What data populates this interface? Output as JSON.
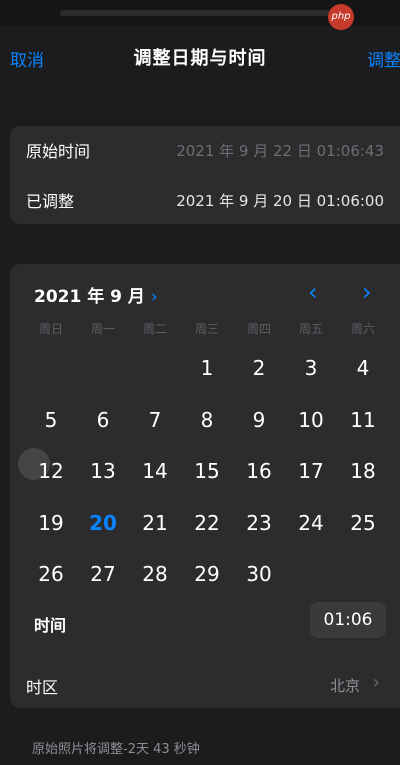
{
  "header": {
    "cancel": "取消",
    "title": "调整日期与时间",
    "adjust": "调整"
  },
  "watermark": "php",
  "original": {
    "label": "原始时间",
    "value": "2021 年 9 月 22 日 01:06:43"
  },
  "adjusted": {
    "label": "已调整",
    "value": "2021 年 9 月 20 日 01:06:00"
  },
  "calendar": {
    "month_label": "2021 年 9 月",
    "month_chevron": "›",
    "prev_icon": "‹",
    "next_icon": "›",
    "weekdays": [
      "周日",
      "周一",
      "周二",
      "周三",
      "周四",
      "周五",
      "周六"
    ],
    "days": [
      [
        "",
        "",
        "",
        "1",
        "2",
        "3",
        "4"
      ],
      [
        "5",
        "6",
        "7",
        "8",
        "9",
        "10",
        "11"
      ],
      [
        "12",
        "13",
        "14",
        "15",
        "16",
        "17",
        "18"
      ],
      [
        "19",
        "20",
        "21",
        "22",
        "23",
        "24",
        "25"
      ],
      [
        "26",
        "27",
        "28",
        "29",
        "30",
        "",
        ""
      ]
    ],
    "selected_day": "20"
  },
  "time": {
    "label": "时间",
    "value": "01:06"
  },
  "timezone": {
    "label": "时区",
    "value": "北京",
    "chevron": "›"
  },
  "footer_note": "原始照片将调整-2天 43 秒钟",
  "colors": {
    "accent": "#0a84ff",
    "background": "#1c1c1e",
    "card": "#2c2c2e"
  }
}
